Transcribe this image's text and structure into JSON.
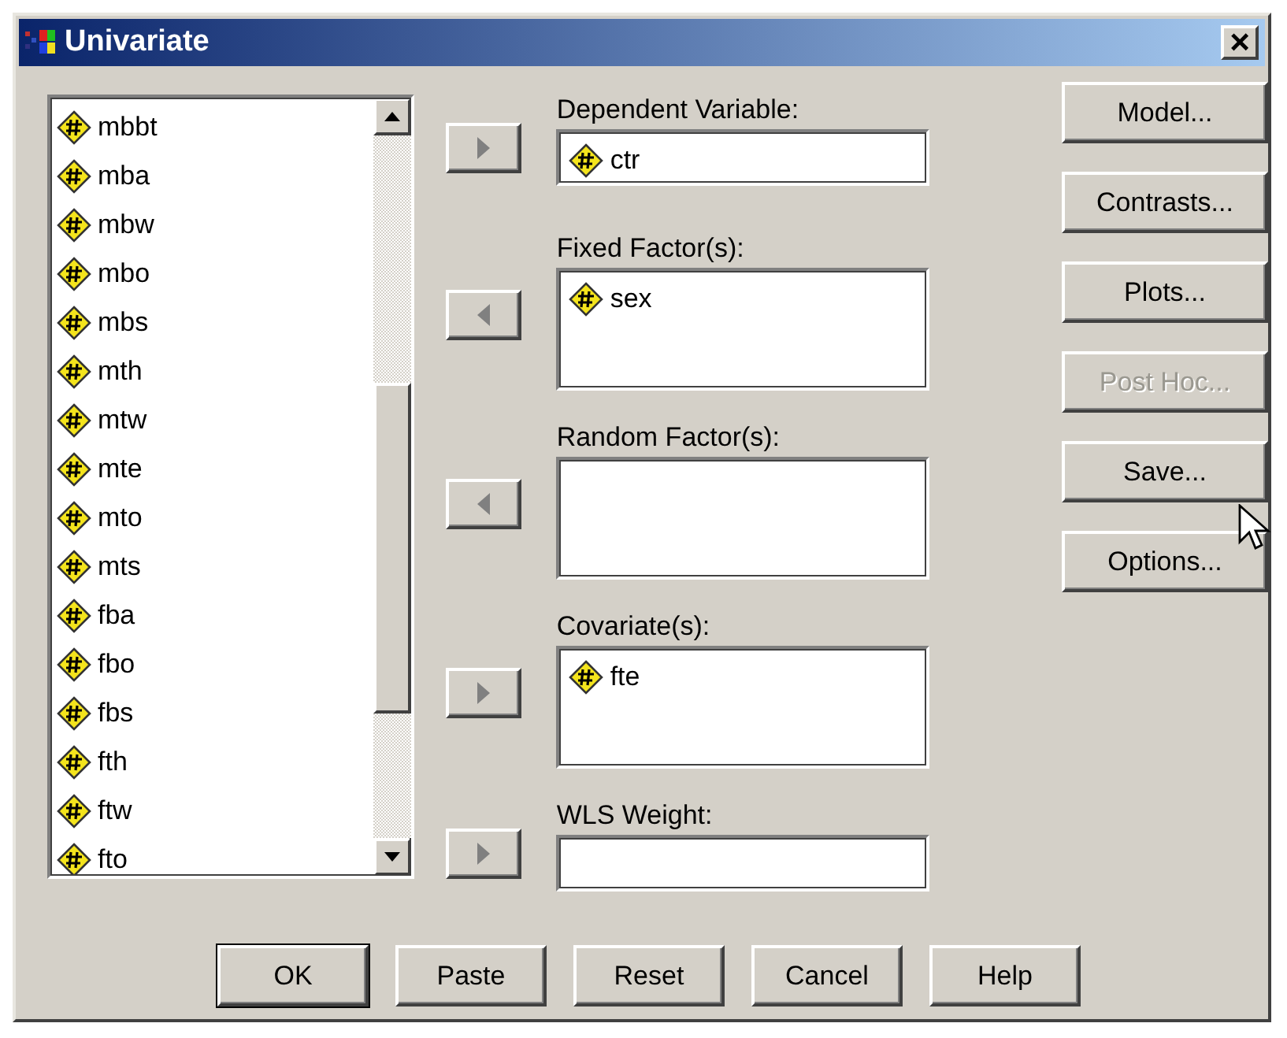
{
  "window": {
    "title": "Univariate",
    "close": "×"
  },
  "source_list": {
    "items": [
      "mbbt",
      "mba",
      "mbw",
      "mbo",
      "mbs",
      "mth",
      "mtw",
      "mte",
      "mto",
      "mts",
      "fba",
      "fbo",
      "fbs",
      "fth",
      "ftw",
      "fto"
    ]
  },
  "targets": [
    {
      "label": "Dependent Variable:",
      "multiline": false,
      "kind": "right",
      "items": [
        "ctr"
      ]
    },
    {
      "label": "Fixed Factor(s):",
      "multiline": true,
      "kind": "left",
      "items": [
        "sex"
      ]
    },
    {
      "label": "Random Factor(s):",
      "multiline": true,
      "kind": "left"
    },
    {
      "label": "Covariate(s):",
      "multiline": true,
      "kind": "right",
      "items": [
        "fte"
      ]
    },
    {
      "label": "WLS Weight:",
      "multiline": false,
      "kind": "right"
    }
  ],
  "side_buttons": [
    {
      "label": "Model...",
      "disabled": false
    },
    {
      "label": "Contrasts...",
      "disabled": false
    },
    {
      "label": "Plots...",
      "disabled": false
    },
    {
      "label": "Post Hoc...",
      "disabled": true
    },
    {
      "label": "Save...",
      "disabled": false
    },
    {
      "label": "Options...",
      "disabled": false
    }
  ],
  "bottom_buttons": [
    {
      "label": "OK",
      "default": true
    },
    {
      "label": "Paste",
      "default": false
    },
    {
      "label": "Reset",
      "default": false
    },
    {
      "label": "Cancel",
      "default": false
    },
    {
      "label": "Help",
      "default": false
    }
  ]
}
